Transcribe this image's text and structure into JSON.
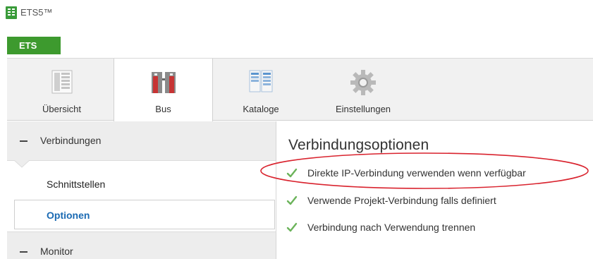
{
  "window": {
    "title": "ETS5™"
  },
  "main_tab": {
    "label": "ETS"
  },
  "ribbon": {
    "tabs": [
      {
        "label": "Übersicht",
        "icon": "overview-icon",
        "active": false
      },
      {
        "label": "Bus",
        "icon": "bus-icon",
        "active": true
      },
      {
        "label": "Kataloge",
        "icon": "catalog-icon",
        "active": false
      },
      {
        "label": "Einstellungen",
        "icon": "gear-icon",
        "active": false
      }
    ]
  },
  "sidebar": {
    "sections": [
      {
        "label": "Verbindungen",
        "expanded": true,
        "items": [
          {
            "label": "Schnittstellen"
          },
          {
            "label": "Optionen",
            "selected": true
          }
        ]
      },
      {
        "label": "Monitor",
        "expanded": true
      }
    ]
  },
  "content": {
    "title": "Verbindungsoptionen",
    "options": [
      {
        "label": "Direkte IP-Verbindung verwenden wenn verfügbar",
        "checked": true,
        "highlighted": true
      },
      {
        "label": "Verwende Projekt-Verbindung falls definiert",
        "checked": true
      },
      {
        "label": "Verbindung nach Verwendung trennen",
        "checked": true
      }
    ]
  },
  "colors": {
    "accent_green": "#3d9a2e",
    "selected_blue": "#1a6ab3",
    "check_green": "#6bb35a",
    "highlight_red": "#d9232e"
  }
}
